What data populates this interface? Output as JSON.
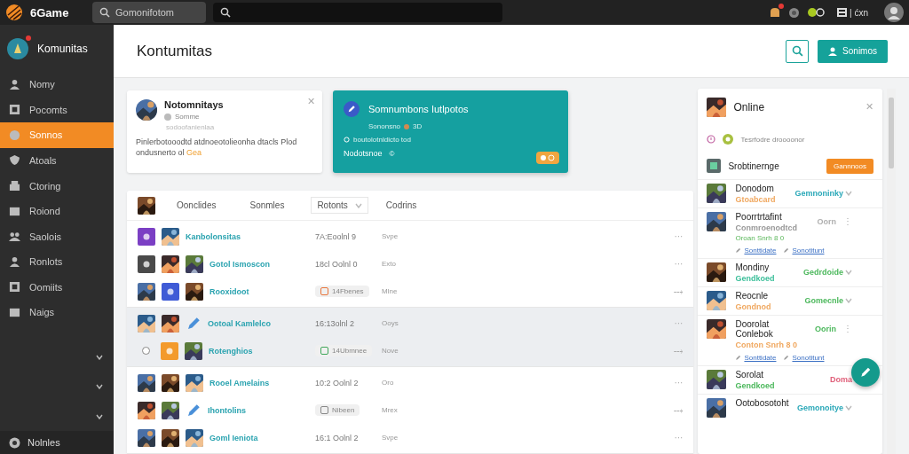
{
  "topbar": {
    "brand": "6Game",
    "search": {
      "placeholder": "Gomonifotom"
    },
    "notifications_badge": true,
    "status_text": "| ćxn"
  },
  "sidebar": {
    "header": {
      "title": "Komunitas",
      "badge": true
    },
    "items": [
      {
        "label": "Nomy",
        "selected": false
      },
      {
        "label": "Pocomts",
        "selected": false
      },
      {
        "label": "Sonnos",
        "selected": true
      },
      {
        "label": "Atoals",
        "selected": false
      },
      {
        "label": "Ctoring",
        "selected": false
      },
      {
        "label": "Roiond",
        "selected": false
      },
      {
        "label": "Saolois",
        "selected": false
      },
      {
        "label": "Ronlots",
        "selected": false
      },
      {
        "label": "Oomiits",
        "selected": false
      },
      {
        "label": "Naigs",
        "selected": false
      }
    ],
    "groups": [
      {
        "expanded": false
      },
      {
        "expanded": false
      },
      {
        "expanded": false
      }
    ],
    "footer": "Nolnles"
  },
  "header": {
    "title": "Kontumitas",
    "action": "Sonimos"
  },
  "profile_card": {
    "close": "✕",
    "name": "Notomnitays",
    "handle": "Somme",
    "faint": "sodoofanienlaa",
    "text": "Pinlerbotooodtd atdnoeotolieonha dtacls Plod ondusnerto ol",
    "highlight": "Gea"
  },
  "feature_card": {
    "title": "Somnumbons Iutlpotos",
    "meta": "Sononsno",
    "meta_tag": "3D",
    "line": "boutolotnldicto tod",
    "footer": "Nodotsnoe",
    "footer_mark": "©"
  },
  "table": {
    "columns": [
      {
        "label": "Oonclides"
      },
      {
        "label": "Sonmles"
      },
      {
        "label": "Rotonts",
        "dropdown": true
      },
      {
        "label": "Codrins"
      }
    ],
    "groups": [
      {
        "shaded": false,
        "rows": [
          {
            "thumbs": [
              {
                "kind": "tile",
                "color": "#7b3fc4"
              },
              {
                "kind": "picture"
              }
            ],
            "name": "Kanbolonsitas",
            "time": {
              "kind": "text",
              "text": "7A:Eoolnl 9"
            },
            "column_4": "Svpe",
            "action": "···"
          },
          {
            "thumbs": [
              {
                "kind": "tile",
                "color": "#4a4a4a"
              },
              {
                "kind": "picture"
              },
              {
                "kind": "picture"
              }
            ],
            "name": "Gotol Ismoscon",
            "time": {
              "kind": "text",
              "text": "18cl Oolnl 0"
            },
            "column_4": "Exto",
            "action": "···"
          },
          {
            "thumbs": [
              {
                "kind": "picture"
              },
              {
                "kind": "tile",
                "color": "#3f5bd6"
              },
              {
                "kind": "picture"
              }
            ],
            "name": "Rooxidoot",
            "time": {
              "kind": "chip",
              "text": "14Fbenes",
              "color": "#e8743a"
            },
            "column_4": "Mlne",
            "action": "⤏"
          }
        ]
      },
      {
        "shaded": true,
        "rows": [
          {
            "thumbs": [
              {
                "kind": "picture"
              },
              {
                "kind": "picture"
              },
              {
                "kind": "pencil"
              }
            ],
            "name": "Ootoal Kamlelco",
            "time": {
              "kind": "text",
              "text": "16:13olnl 2"
            },
            "column_4": "Ooys",
            "action": "···"
          },
          {
            "thumbs": [
              {
                "kind": "radio",
                "checked": false
              },
              {
                "kind": "tile",
                "color": "#f39a2b"
              },
              {
                "kind": "picture"
              }
            ],
            "name": "Rotenghios",
            "time": {
              "kind": "chip",
              "text": "14Ubmnee",
              "color": "#3fa65a"
            },
            "column_4": "Nove",
            "action": "⤏"
          }
        ]
      },
      {
        "shaded": false,
        "rows": [
          {
            "thumbs": [
              {
                "kind": "picture"
              },
              {
                "kind": "picture"
              },
              {
                "kind": "picture"
              }
            ],
            "name": "Rooel Amelains",
            "time": {
              "kind": "text",
              "text": "10:2 Oolnl 2"
            },
            "column_4": "Oro",
            "action": "···"
          },
          {
            "thumbs": [
              {
                "kind": "picture"
              },
              {
                "kind": "picture"
              },
              {
                "kind": "pencil"
              }
            ],
            "name": "Ihontolins",
            "time": {
              "kind": "chip",
              "text": "Nibeen",
              "color": "#888888"
            },
            "column_4": "Mrex",
            "action": "⤏"
          },
          {
            "thumbs": [
              {
                "kind": "picture"
              },
              {
                "kind": "picture"
              },
              {
                "kind": "picture"
              }
            ],
            "name": "Goml Ieniota",
            "time": {
              "kind": "text",
              "text": "16:1 Oolnl 2"
            },
            "column_4": "Svpe",
            "action": "···"
          }
        ]
      }
    ]
  },
  "online_panel": {
    "close": "✕",
    "title": "Online",
    "notice": "Tesrfodre droooonor",
    "group": {
      "name": "Srobtinernge",
      "button": "Gannnoos"
    },
    "members": [
      {
        "name": "Donodom",
        "status": {
          "text": "Gtoabcard",
          "color": "#f0a860"
        },
        "action": {
          "text": "Gemnoninky",
          "color": "#2aa8b8",
          "dropdown": true
        }
      },
      {
        "name": "Poorrtrtafint",
        "status": {
          "text": "Conmroenodtcd",
          "color": "#999999"
        },
        "detail": "Oroan Snrh 8 0",
        "action": {
          "text": "Oorn",
          "color": "#b0b0b0",
          "dropdown": false
        },
        "menu": "⋮",
        "links": [
          "Sonttidate",
          "Sonotitunt"
        ]
      },
      {
        "name": "Mondiny",
        "status": {
          "text": "Gendkoed",
          "color": "#3cbf9a"
        },
        "action": {
          "text": "Gedrdoide",
          "color": "#4cb85c",
          "dropdown": true
        }
      },
      {
        "name": "Reocnle",
        "status": {
          "text": "Gondnod",
          "color": "#f0a860"
        },
        "action": {
          "text": "Gomecnle",
          "color": "#4cb85c",
          "dropdown": true
        }
      },
      {
        "name": "Doorolat Conlebok",
        "status": {
          "text": "Conton Snrh 8 0",
          "color": "#f0a860"
        },
        "action": {
          "text": "Oorin",
          "color": "#4cb85c",
          "dropdown": false
        },
        "menu": "⋮",
        "links": [
          "Sonttidate",
          "Sonotitunt"
        ]
      },
      {
        "name": "Sorolat",
        "status": {
          "text": "Gendkoed",
          "color": "#4cb85c"
        },
        "action": {
          "text": "Doma",
          "color": "#e0607a",
          "dropdown": false
        }
      },
      {
        "name": "Ootobosotoht",
        "action": {
          "text": "Gemonoitye",
          "color": "#2aa8b8",
          "dropdown": true
        }
      }
    ]
  }
}
